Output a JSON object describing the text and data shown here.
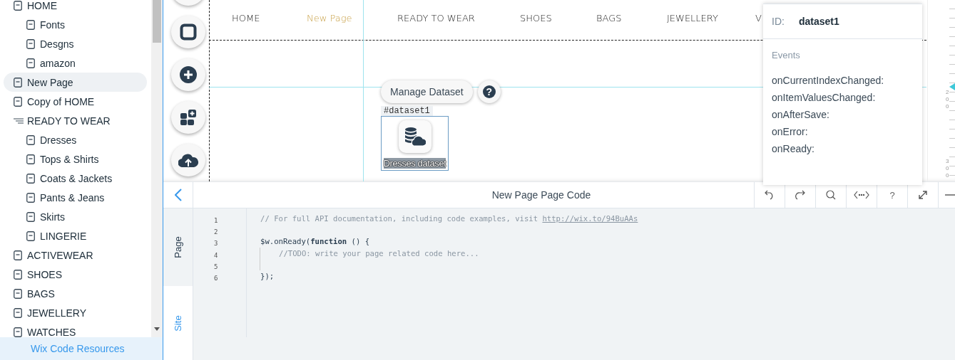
{
  "sidebar": {
    "items": [
      {
        "label": "HOME",
        "kind": "page",
        "selected": false,
        "children": [
          {
            "label": "Fonts",
            "kind": "page",
            "selected": false
          },
          {
            "label": "Desgns",
            "kind": "page",
            "selected": false
          },
          {
            "label": "amazon",
            "kind": "page",
            "selected": false
          }
        ]
      },
      {
        "label": "New Page",
        "kind": "page",
        "selected": true
      },
      {
        "label": "Copy of HOME",
        "kind": "page",
        "selected": false
      },
      {
        "label": "READY TO WEAR",
        "kind": "menu",
        "selected": false,
        "children": [
          {
            "label": "Dresses",
            "kind": "page",
            "selected": false
          },
          {
            "label": "Tops & Shirts",
            "kind": "page",
            "selected": false
          },
          {
            "label": "Coats & Jackets",
            "kind": "page",
            "selected": false
          },
          {
            "label": "Pants & Jeans",
            "kind": "page",
            "selected": false
          },
          {
            "label": "Skirts",
            "kind": "page",
            "selected": false
          },
          {
            "label": "LINGERIE",
            "kind": "page",
            "selected": false
          }
        ]
      },
      {
        "label": "ACTIVEWEAR",
        "kind": "page",
        "selected": false
      },
      {
        "label": "SHOES",
        "kind": "page",
        "selected": false
      },
      {
        "label": "BAGS",
        "kind": "page",
        "selected": false
      },
      {
        "label": "JEWELLERY",
        "kind": "page",
        "selected": false
      },
      {
        "label": "WATCHES",
        "kind": "page",
        "selected": false
      }
    ],
    "footer": "Wix Code Resources"
  },
  "canvas": {
    "nav": [
      {
        "label": "HOME",
        "selected": false
      },
      {
        "label": "New Page",
        "selected": true
      },
      {
        "label": "READY TO WEAR",
        "selected": false
      },
      {
        "label": "SHOES",
        "selected": false
      },
      {
        "label": "BAGS",
        "selected": false
      },
      {
        "label": "JEWELLERY",
        "selected": false
      },
      {
        "label": "V",
        "selected": false
      }
    ],
    "manage_button": "Manage Dataset",
    "help": "?",
    "dataset_tag": "#dataset1",
    "dataset_label": "Dresses dataset",
    "ruler": [
      "200",
      "300"
    ]
  },
  "properties": {
    "id_label": "ID:",
    "id_value": "dataset1",
    "events_heading": "Events",
    "events": [
      "onCurrentIndexChanged:",
      "onItemValuesChanged:",
      "onAfterSave:",
      "onError:",
      "onReady:"
    ]
  },
  "code_panel": {
    "title": "New Page Page Code",
    "help": "?",
    "tabs": [
      {
        "label": "Page",
        "selected": true
      },
      {
        "label": "Site",
        "selected": false
      }
    ],
    "lines": [
      {
        "number": "1",
        "kind": "comment",
        "text": "// For full API documentation, including code examples, visit ",
        "link": "http://wix.to/94BuAAs"
      },
      {
        "number": "2",
        "kind": "blank"
      },
      {
        "number": "3",
        "kind": "code",
        "text": "$w.onReady(**function** () {"
      },
      {
        "number": "4",
        "kind": "comment",
        "indent": true,
        "text": "//TODO: write your page related code here..."
      },
      {
        "number": "5",
        "kind": "blank"
      },
      {
        "number": "6",
        "kind": "code",
        "text": "});"
      }
    ]
  }
}
